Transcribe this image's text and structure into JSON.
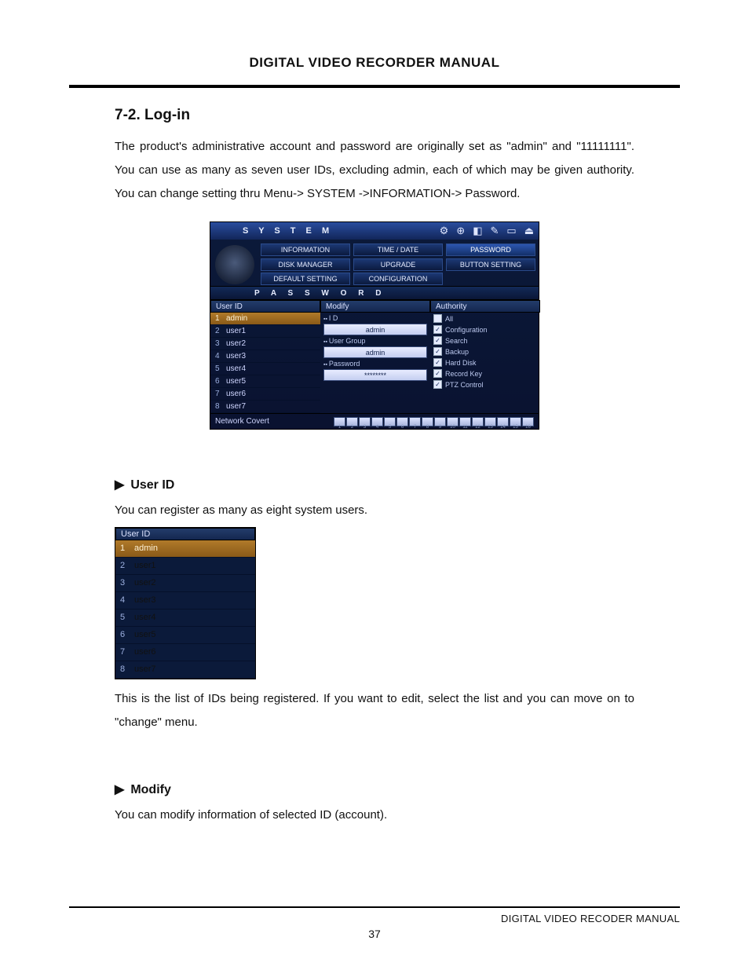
{
  "doc_title": "DIGITAL VIDEO RECORDER MANUAL",
  "section_heading": "7-2. Log-in",
  "body_text": "The product's administrative account and password are originally set as \"admin\" and \"11111111\". You can use as many as seven user IDs, excluding admin, each of which may be given authority. You can change setting thru Menu-> SYSTEM ->INFORMATION-> Password.",
  "dvr": {
    "title": "S Y S T E M",
    "top_icons": [
      "⚙",
      "⊕",
      "◧",
      "✎",
      "▭",
      "⏏"
    ],
    "tabs": [
      "INFORMATION",
      "TIME / DATE",
      "PASSWORD",
      "DISK MANAGER",
      "UPGRADE",
      "BUTTON SETTING",
      "DEFAULT SETTING",
      "CONFIGURATION",
      ""
    ],
    "tab_selected": 2,
    "panel_title": "P A S S W O R D",
    "col_headers": [
      "User ID",
      "Modify",
      "Authority"
    ],
    "users": [
      {
        "n": "1",
        "name": "admin",
        "selected": true
      },
      {
        "n": "2",
        "name": "user1"
      },
      {
        "n": "3",
        "name": "user2"
      },
      {
        "n": "4",
        "name": "user3"
      },
      {
        "n": "5",
        "name": "user4"
      },
      {
        "n": "6",
        "name": "user5"
      },
      {
        "n": "7",
        "name": "user6"
      },
      {
        "n": "8",
        "name": "user7"
      }
    ],
    "modify": {
      "id_label": "I D",
      "id_value": "admin",
      "group_label": "User Group",
      "group_value": "admin",
      "pw_label": "Password",
      "pw_value": "********"
    },
    "authority": [
      {
        "label": "All",
        "checked": false
      },
      {
        "label": "Configuration",
        "checked": true
      },
      {
        "label": "Search",
        "checked": true
      },
      {
        "label": "Backup",
        "checked": true
      },
      {
        "label": "Hard Disk",
        "checked": true
      },
      {
        "label": "Record Key",
        "checked": true
      },
      {
        "label": "PTZ Control",
        "checked": true
      }
    ],
    "network_covert_label": "Network Covert",
    "channels": 16
  },
  "userid_heading": "User ID",
  "userid_text": "You can register as many as eight system users.",
  "userid_after": "This is the list of IDs being registered. If you want to edit, select the list and you can move on to \"change\" menu.",
  "modify_heading": "Modify",
  "modify_text": "You can modify information of selected ID (account).",
  "footer_text": "DIGITAL VIDEO RECODER MANUAL",
  "page_number": "37"
}
